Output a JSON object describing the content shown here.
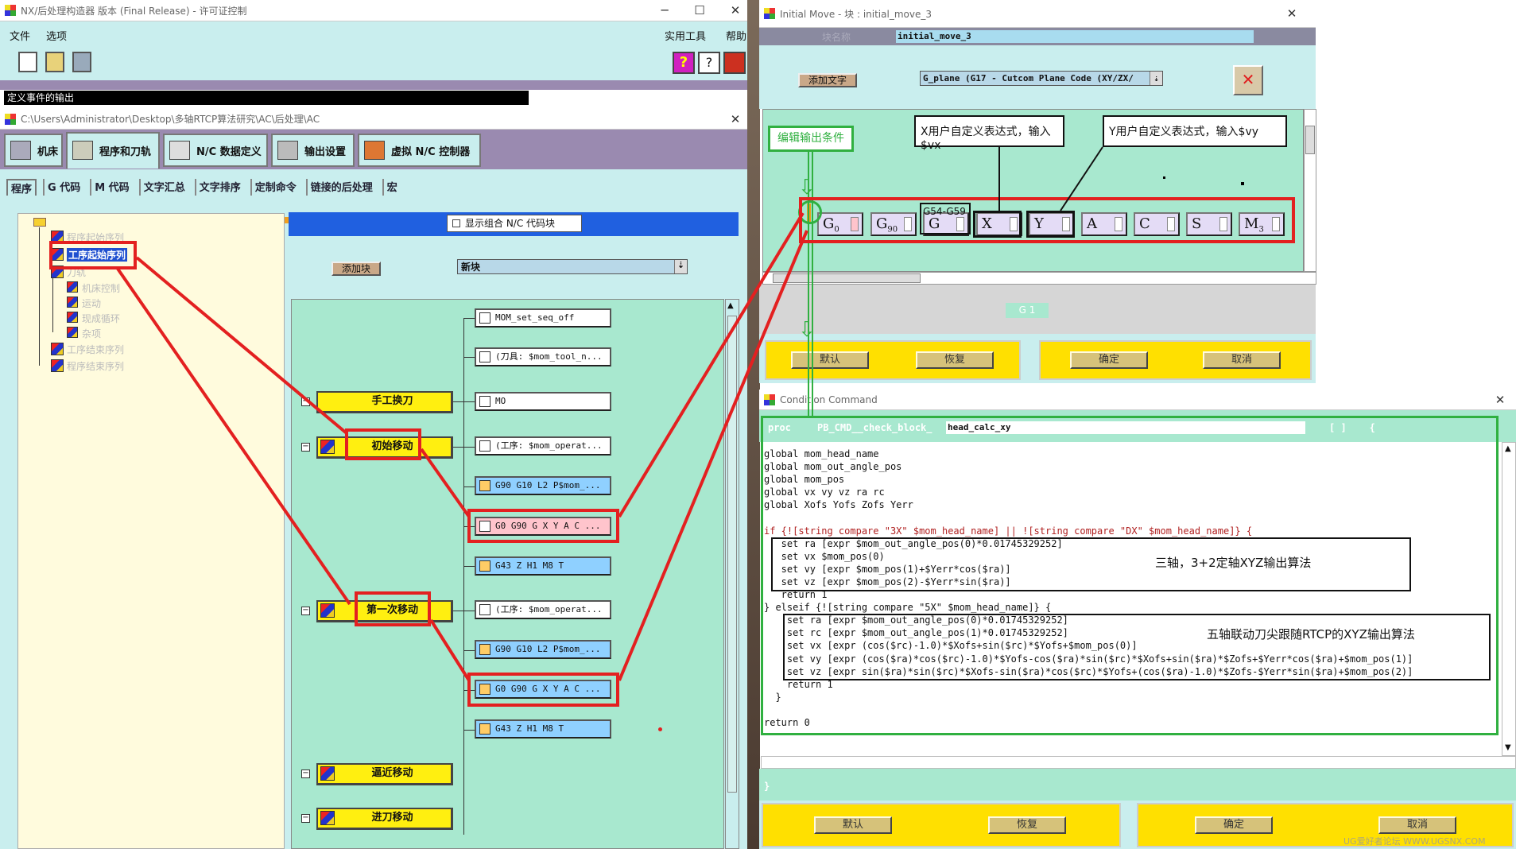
{
  "postbuilder": {
    "title": "NX/后处理构造器 版本 (Final Release) - 许可证控制",
    "menu": [
      "文件",
      "选项"
    ],
    "menu_right": [
      "实用工具",
      "帮助"
    ],
    "status_bar": "定义事件的输出"
  },
  "project": {
    "title": "C:\\Users\\Administrator\\Desktop\\多轴RTCP算法研究\\AC\\后处理\\AC",
    "main_tabs": [
      "机床",
      "程序和刀轨",
      "N/C 数据定义",
      "输出设置",
      "虚拟 N/C 控制器"
    ],
    "sub_tabs": [
      "程序",
      "G 代码",
      "M 代码",
      "文字汇总",
      "文字排序",
      "定制命令",
      "链接的后处理",
      "宏"
    ],
    "tree": {
      "start_program": "程序起始序列",
      "op_start": "工序起始序列",
      "toolpath": "刀轨",
      "machine_control": "机床控制",
      "motion": "运动",
      "canned_cycle": "现成循环",
      "misc": "杂项",
      "op_end": "工序结束序列",
      "end_program": "程序结束序列"
    },
    "show_combined_label": "显示组合 N/C 代码块",
    "add_block_button": "添加块",
    "new_block": "新块",
    "events": [
      {
        "name": "手工换刀",
        "blocks": [
          "MO"
        ]
      },
      {
        "name": "初始移动",
        "blocks": [
          "(工序: $mom_operat...",
          "G90 G10 L2 P$mom_...",
          "G0 G90 G X Y A C ...",
          "G43 Z H1 M8 T"
        ]
      },
      {
        "name": "第一次移动",
        "blocks": [
          "(工序: $mom_operat...",
          "G90 G10 L2 P$mom_...",
          "G0 G90 G X Y A C ...",
          "G43 Z H1 M8 T"
        ]
      },
      {
        "name": "逼近移动",
        "blocks": []
      },
      {
        "name": "进刀移动",
        "blocks": []
      }
    ],
    "pre_blocks": [
      "MOM_set_seq_off",
      "(刀具: $mom_tool_n..."
    ]
  },
  "initial_move": {
    "title": "Initial Move - 块 : initial_move_3",
    "block_name_label": "块名称",
    "block_name": "initial_move_3",
    "add_word_button": "添加文字",
    "word_select": "G_plane (G17 - Cutcom Plane Code (XY/ZX/",
    "cells": [
      "G",
      "G",
      "G",
      "X",
      "Y",
      "A",
      "C",
      "S",
      "M"
    ],
    "cell_subs": [
      "0",
      "90",
      "",
      "",
      "",
      "",
      "",
      "",
      "3"
    ],
    "g54_label": "G54-G59",
    "preview": "G 1",
    "buttons": [
      "默认",
      "恢复",
      "确定",
      "取消"
    ],
    "annot_edit_condition": "编辑输出条件",
    "annot_x": "X用户自定义表达式，输入$vx",
    "annot_y": "Y用户自定义表达式，输入$vy"
  },
  "condition": {
    "title": "Condition Command",
    "proc_prefix": "proc",
    "proc_name_prefix": "PB_CMD__check_block_",
    "proc_name": "head_calc_xy",
    "braces": "[ ]    {",
    "code": [
      "global mom_head_name",
      "global mom_out_angle_pos",
      "global mom_pos",
      "global vx vy vz ra rc",
      "global Xofs Yofs Zofs Yerr",
      "",
      "if {![string compare \"3X\" $mom_head_name] || ![string compare \"DX\" $mom_head_name]} {",
      "   set ra [expr $mom_out_angle_pos(0)*0.01745329252]",
      "   set vx $mom_pos(0)",
      "   set vy [expr $mom_pos(1)+$Yerr*cos($ra)]",
      "   set vz [expr $mom_pos(2)-$Yerr*sin($ra)]",
      "   return 1",
      "} elseif {![string compare \"5X\" $mom_head_name]} {",
      "    set ra [expr $mom_out_angle_pos(0)*0.01745329252]",
      "    set rc [expr $mom_out_angle_pos(1)*0.01745329252]",
      "    set vx [expr (cos($rc)-1.0)*$Xofs+sin($rc)*$Yofs+$mom_pos(0)]",
      "    set vy [expr (cos($ra)*cos($rc)-1.0)*$Yofs-cos($ra)*sin($rc)*$Xofs+sin($ra)*$Zofs+$Yerr*cos($ra)+$mom_pos(1)]",
      "    set vz [expr sin($ra)*sin($rc)*$Xofs-sin($ra)*cos($rc)*$Yofs+(cos($ra)-1.0)*$Zofs-$Yerr*sin($ra)+$mom_pos(2)]",
      "    return 1",
      "  }",
      "",
      "return 0"
    ],
    "closing_brace": "}",
    "annot_3axis": "三轴，3+2定轴XYZ输出算法",
    "annot_5axis": "五轴联动刀尖跟随RTCP的XYZ输出算法",
    "buttons": [
      "默认",
      "恢复",
      "确定",
      "取消"
    ],
    "watermark": "UG爱好者论坛 WWW.UGSNX.COM"
  },
  "colors": {
    "accent_red": "#e32020",
    "tree_bg": "#fffbdd",
    "panel_green": "#a8e8cf",
    "yellow": "#ffe000"
  }
}
